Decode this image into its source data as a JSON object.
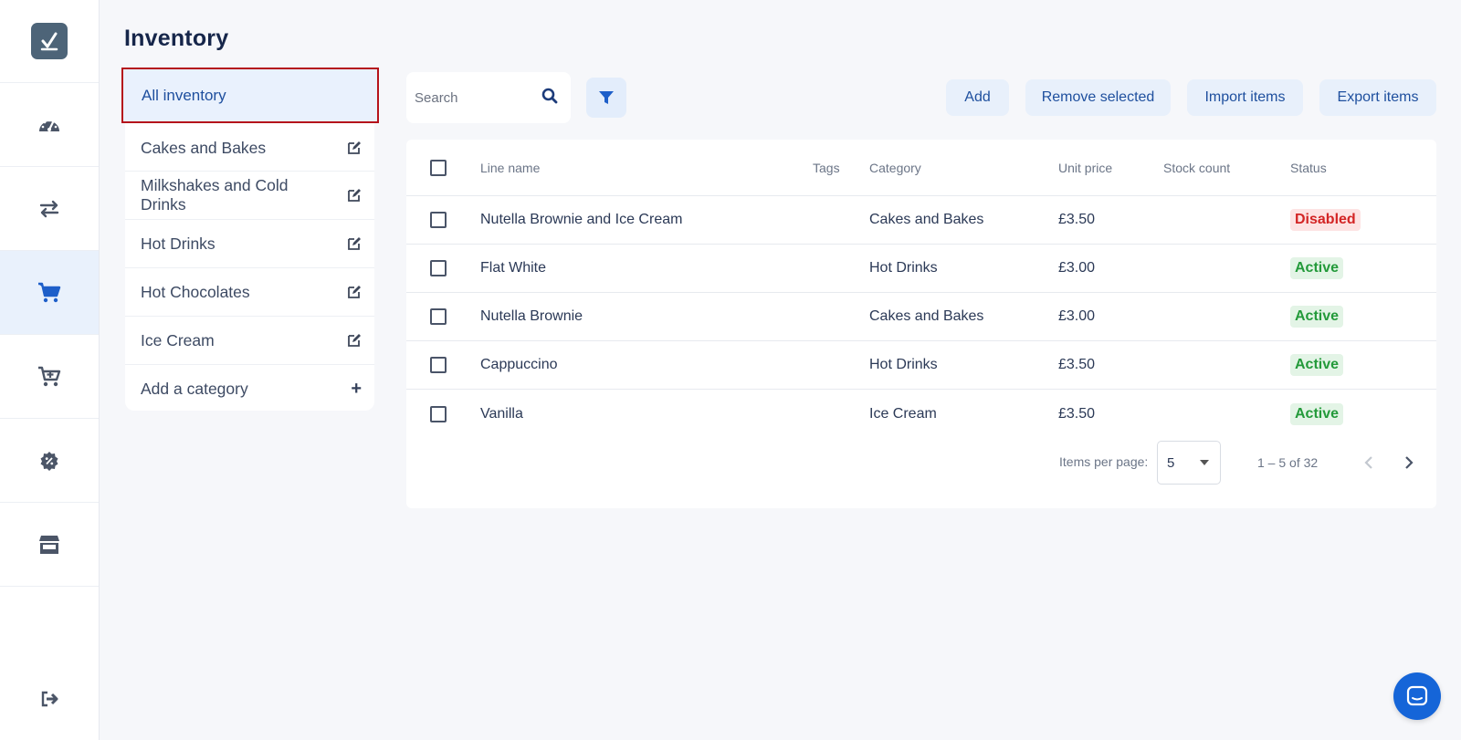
{
  "page": {
    "title": "Inventory"
  },
  "sidebar": {
    "logo": "checkmark-logo-icon",
    "items": [
      {
        "icon": "dashboard-gauge-icon"
      },
      {
        "icon": "transfer-arrows-icon"
      },
      {
        "icon": "cart-icon",
        "active": true
      },
      {
        "icon": "cart-plus-icon"
      },
      {
        "icon": "discount-badge-icon"
      },
      {
        "icon": "store-icon"
      }
    ],
    "logout_icon": "logout-icon"
  },
  "categories": {
    "all_label": "All inventory",
    "items": [
      {
        "label": "Cakes and Bakes",
        "icon": "edit-icon"
      },
      {
        "label": "Milkshakes and Cold Drinks",
        "icon": "edit-icon"
      },
      {
        "label": "Hot Drinks",
        "icon": "edit-icon"
      },
      {
        "label": "Hot Chocolates",
        "icon": "edit-icon"
      },
      {
        "label": "Ice Cream",
        "icon": "edit-icon"
      }
    ],
    "add_label": "Add a category",
    "add_icon": "+"
  },
  "toolbar": {
    "search_placeholder": "Search",
    "add_label": "Add",
    "remove_label": "Remove selected",
    "import_label": "Import items",
    "export_label": "Export items"
  },
  "table": {
    "headers": {
      "line_name": "Line name",
      "tags": "Tags",
      "category": "Category",
      "unit_price": "Unit price",
      "stock_count": "Stock count",
      "status": "Status"
    },
    "rows": [
      {
        "name": "Nutella Brownie and Ice Cream",
        "tags": "",
        "category": "Cakes and Bakes",
        "price": "£3.50",
        "stock": "",
        "status": "Disabled",
        "status_type": "disabled"
      },
      {
        "name": "Flat White",
        "tags": "",
        "category": "Hot Drinks",
        "price": "£3.00",
        "stock": "",
        "status": "Active",
        "status_type": "active"
      },
      {
        "name": "Nutella Brownie",
        "tags": "",
        "category": "Cakes and Bakes",
        "price": "£3.00",
        "stock": "",
        "status": "Active",
        "status_type": "active"
      },
      {
        "name": "Cappuccino",
        "tags": "",
        "category": "Hot Drinks",
        "price": "£3.50",
        "stock": "",
        "status": "Active",
        "status_type": "active"
      },
      {
        "name": "Vanilla",
        "tags": "",
        "category": "Ice Cream",
        "price": "£3.50",
        "stock": "",
        "status": "Active",
        "status_type": "active"
      }
    ]
  },
  "pagination": {
    "items_per_page_label": "Items per page:",
    "items_per_page_value": "5",
    "range_label": "1 – 5 of 32"
  },
  "colors": {
    "accent": "#1565d8",
    "active_badge": "#239a3a",
    "disabled_badge": "#d32525",
    "selected_highlight": "#b5121b"
  }
}
